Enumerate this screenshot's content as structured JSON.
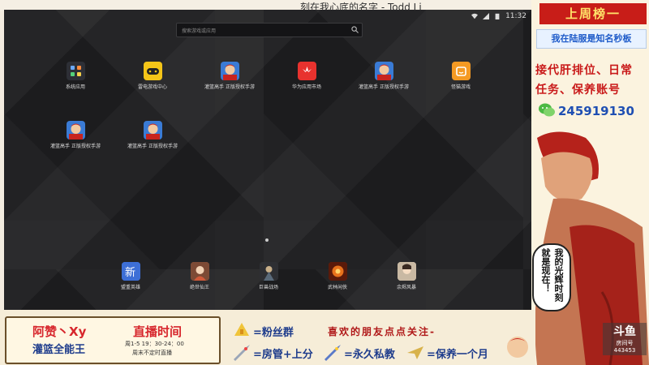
{
  "topbar": {
    "song": "刻在我心底的名字 - Todd Li"
  },
  "status": {
    "time": "11:32"
  },
  "search": {
    "placeholder": "搜索游戏或应用"
  },
  "apps_row1": [
    {
      "label": "系统应用",
      "icon": "grid-icon"
    },
    {
      "label": "雷电游戏中心",
      "icon": "gamepad-icon"
    },
    {
      "label": "灌篮高手 正版授权手游",
      "icon": "slamdunk-icon"
    },
    {
      "label": "华为应用市场",
      "icon": "huawei-icon"
    },
    {
      "label": "灌篮高手 正版授权手游",
      "icon": "slamdunk-icon"
    },
    {
      "label": "怪猫游戏",
      "icon": "cat-icon"
    }
  ],
  "apps_row2": [
    {
      "label": "灌篮高手 正版授权手游",
      "icon": "slamdunk-icon"
    },
    {
      "label": "灌篮高手 正版授权手游",
      "icon": "slamdunk-icon"
    }
  ],
  "dock": [
    {
      "label": "盟重英雄",
      "icon": "game-icon"
    },
    {
      "label": "绝世仙王",
      "icon": "game-icon"
    },
    {
      "label": "巨兽战场",
      "icon": "game-icon"
    },
    {
      "label": "武林闲侠",
      "icon": "game-icon"
    },
    {
      "label": "余烬风暴",
      "icon": "game-icon"
    }
  ],
  "side": {
    "head": "上周榜一",
    "sub": "我在陆服是知名秒板",
    "line1": "接代肝排位、日常",
    "line2": "任务、保养账号",
    "qq": "245919130",
    "bubble_col1": "我的光辉时刻",
    "bubble_col2": "就是现在！"
  },
  "bottom": {
    "name": "阿赞丶Xy",
    "title": "灌篮全能王",
    "live_label": "直播时间",
    "schedule1": "周1-5 19：30-24：00",
    "schedule2": "周末不定时直播",
    "fan": "=粉丝群",
    "follow": "喜欢的朋友点点关注-",
    "admin": "=房管+上分",
    "private": "=永久私教",
    "maintain": "=保养一个月"
  },
  "logo": {
    "text": "斗鱼",
    "sub": "房间号",
    "room": "443453"
  },
  "colors": {
    "accent_red": "#c81d18",
    "blue": "#1f4fb3"
  }
}
